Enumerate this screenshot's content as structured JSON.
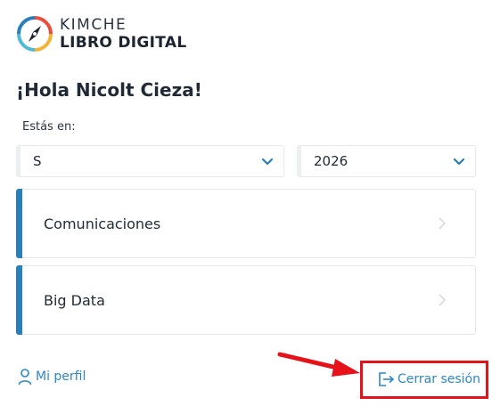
{
  "brand": {
    "line1": "KIMCHE",
    "line2": "LIBRO DIGITAL",
    "colors": [
      "#e94e3d",
      "#f5b234",
      "#2a7fb6",
      "#4fbad4"
    ]
  },
  "greeting": "¡Hola Nicolt Cieza!",
  "location": {
    "label": "Estás en:",
    "school_select": {
      "value": "S",
      "icon": "chevron-down-icon"
    },
    "year_select": {
      "value": "2026",
      "icon": "chevron-down-icon"
    }
  },
  "cards": [
    {
      "label": "Comunicaciones",
      "icon": "chevron-right-icon"
    },
    {
      "label": "Big Data",
      "icon": "chevron-right-icon"
    }
  ],
  "footer": {
    "profile_label": "Mi perfil",
    "logout_label": "Cerrar sesión"
  },
  "colors": {
    "accent": "#2a7fb6",
    "link": "#2b87c6",
    "highlight": "#e5121a"
  }
}
